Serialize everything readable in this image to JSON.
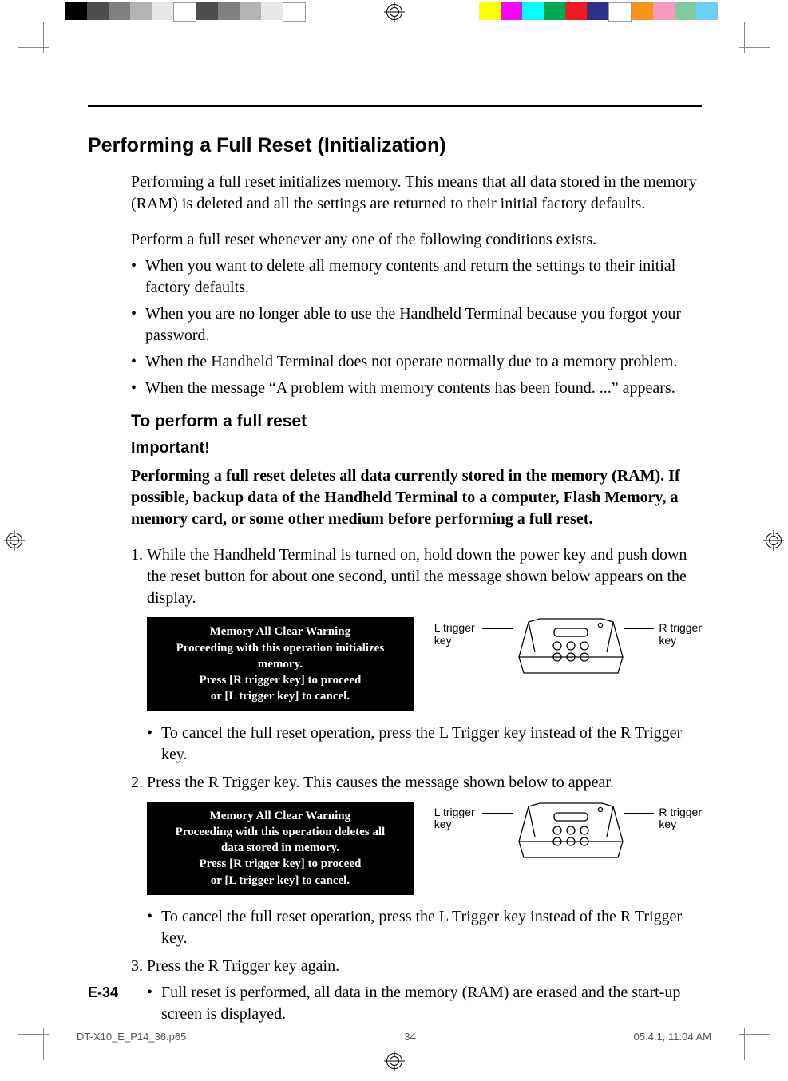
{
  "printMarks": {
    "leftSwatches": [
      "#000000",
      "#4d4d4d",
      "#808080",
      "#b3b3b3",
      "#e6e6e6",
      "#ffffff",
      "#4d4d4d",
      "#808080",
      "#b3b3b3",
      "#e6e6e6",
      "#ffffff"
    ],
    "rightSwatches": [
      "#ffff00",
      "#ff00ff",
      "#00ffff",
      "#00a651",
      "#ed1c24",
      "#2e3192",
      "#ffffff",
      "#f7941d",
      "#f49ac1",
      "#82ca9c",
      "#6dcff6"
    ]
  },
  "title": "Performing a Full Reset (Initialization)",
  "intro": "Performing a full reset initializes memory. This means that all data stored in the memory (RAM) is deleted and all the settings are returned to their initial factory defaults.",
  "conditionsLead": "Perform a full reset whenever any one of the following conditions exists.",
  "conditions": [
    "When you want to delete all memory contents and return the settings to their initial factory defaults.",
    "When you are no longer able to use the Handheld Terminal because you forgot your password.",
    "When the Handheld Terminal does not operate normally due to a memory problem.",
    "When the message “A problem with memory contents has been found. ...” appears."
  ],
  "subhead": "To perform a full reset",
  "important": "Important!",
  "importantBody": "Performing a full reset deletes all data currently stored in the memory (RAM). If possible, backup data of the Handheld Terminal to a computer, Flash Memory, a memory card, or some other medium before performing a full reset.",
  "step1": {
    "num": "1.",
    "text": "While the Handheld Terminal is turned on, hold down the power key and push down the reset button for about one second, until the message shown below appears on the display."
  },
  "msg1": {
    "l1": "Memory All Clear Warning",
    "l2": "Proceeding with this operation initializes memory.",
    "l3": "Press [R trigger key] to proceed",
    "l4": "or [L trigger key] to cancel."
  },
  "cancelNote": "To cancel the full reset operation, press the L Trigger key instead of the R Trigger key.",
  "step2": {
    "num": "2.",
    "text": "Press the R Trigger key. This causes the message shown below to appear."
  },
  "msg2": {
    "l1": "Memory All Clear Warning",
    "l2": "Proceeding with this operation deletes all",
    "l3": "data stored in memory.",
    "l4": "Press [R trigger key] to proceed",
    "l5": "or [L trigger key] to cancel."
  },
  "step3": {
    "num": "3.",
    "text": "Press the R Trigger key again."
  },
  "result": "Full reset is performed, all data in the memory (RAM) are erased and the start-up screen is displayed.",
  "figLabels": {
    "left": "L trigger\nkey",
    "right": "R trigger\nkey"
  },
  "pageNumber": "E-34",
  "footer": {
    "file": "DT-X10_E_P14_36.p65",
    "page": "34",
    "timestamp": "05.4.1, 11:04 AM"
  }
}
